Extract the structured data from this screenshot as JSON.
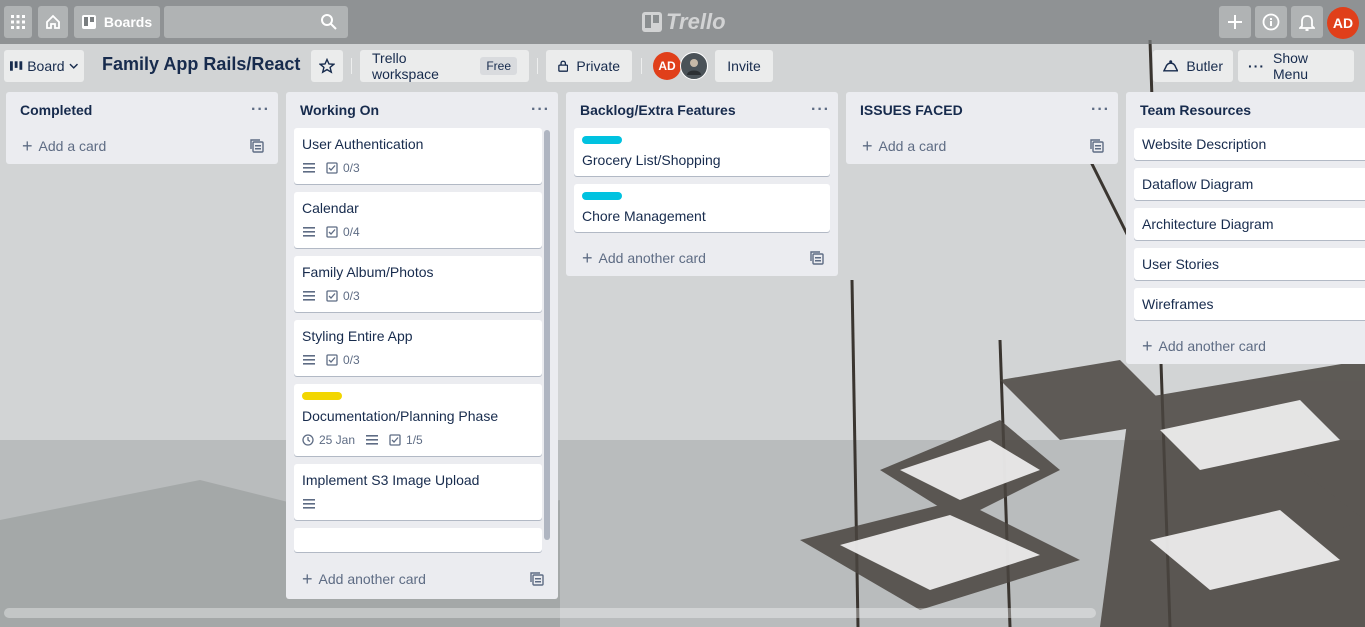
{
  "topnav": {
    "boards_label": "Boards",
    "logo_text": "Trello",
    "user_initials": "AD"
  },
  "board_header": {
    "view_label": "Board",
    "title": "Family App Rails/React",
    "workspace_label": "Trello workspace",
    "workspace_badge": "Free",
    "visibility_label": "Private",
    "member_initials": "AD",
    "invite_label": "Invite",
    "butler_label": "Butler",
    "show_menu_label": "Show Menu"
  },
  "lists": [
    {
      "name": "Completed",
      "cards": [],
      "add_label": "Add a card"
    },
    {
      "name": "Working On",
      "cards": [
        {
          "title": "User Authentication",
          "checklist": "0/3"
        },
        {
          "title": "Calendar",
          "checklist": "0/4"
        },
        {
          "title": "Family Album/Photos",
          "checklist": "0/3"
        },
        {
          "title": "Styling Entire App",
          "checklist": "0/3"
        },
        {
          "title": "Documentation/Planning Phase",
          "label_color": "#f2d600",
          "due": "25 Jan",
          "checklist": "1/5"
        },
        {
          "title": "Implement S3 Image Upload"
        }
      ],
      "add_label": "Add another card"
    },
    {
      "name": "Backlog/Extra Features",
      "cards": [
        {
          "title": "Grocery List/Shopping",
          "label_color": "#00c2e0"
        },
        {
          "title": "Chore Management",
          "label_color": "#00c2e0"
        }
      ],
      "add_label": "Add another card"
    },
    {
      "name": "ISSUES FACED",
      "cards": [],
      "add_label": "Add a card"
    },
    {
      "name": "Team Resources",
      "cards": [
        {
          "title": "Website Description"
        },
        {
          "title": "Dataflow Diagram"
        },
        {
          "title": "Architecture Diagram"
        },
        {
          "title": "User Stories"
        },
        {
          "title": "Wireframes"
        }
      ],
      "add_label": "Add another card"
    }
  ],
  "colors": {
    "accent_avatar": "#e03f1a",
    "label_cyan": "#00c2e0",
    "label_yellow": "#f2d600"
  }
}
